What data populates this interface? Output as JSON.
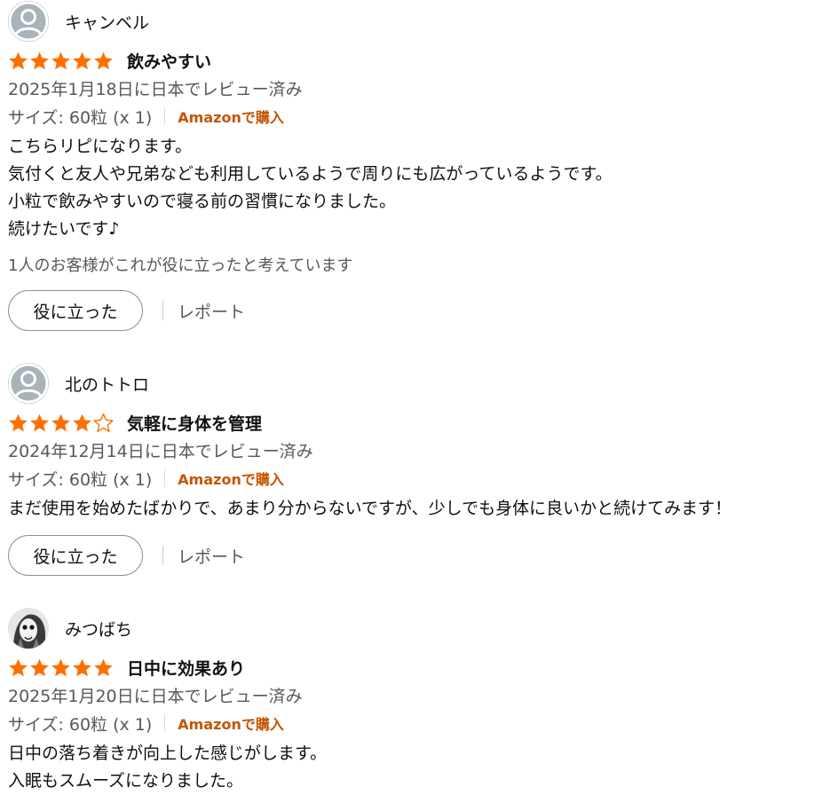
{
  "colors": {
    "star_fill": "#ff6f00",
    "star_empty": "#ff6f00",
    "verified": "#c45500",
    "secondary_text": "#565959",
    "avatar_bg": "#a8b3ba"
  },
  "reviews": [
    {
      "profile_name": "キャンベル",
      "avatar_icon": "default-person-icon",
      "rating": 5,
      "rating_max": 5,
      "title": "飲みやすい",
      "date": "2025年1月18日に日本でレビュー済み",
      "variant": "サイズ: 60粒 (x 1)",
      "verified_label": "Amazonで購入",
      "body": [
        "こちらリピになります。",
        "気付くと友人や兄弟なども利用しているようで周りにも広がっているようです。",
        "小粒で飲みやすいので寝る前の習慣になりました。",
        "続けたいです♪"
      ],
      "helpful_count": "1人のお客様がこれが役に立ったと考えています",
      "helpful_button": "役に立った",
      "report_link": "レポート"
    },
    {
      "profile_name": "北のトトロ",
      "avatar_icon": "default-person-icon",
      "rating": 4,
      "rating_max": 5,
      "title": "気軽に身体を管理",
      "date": "2024年12月14日に日本でレビュー済み",
      "variant": "サイズ: 60粒 (x 1)",
      "verified_label": "Amazonで購入",
      "body": [
        "まだ使用を始めたばかりで、あまり分からないですが、少しでも身体に良いかと続けてみます！"
      ],
      "helpful_count": "",
      "helpful_button": "役に立った",
      "report_link": "レポート"
    },
    {
      "profile_name": "みつばち",
      "avatar_icon": "photo-avatar-icon",
      "rating": 5,
      "rating_max": 5,
      "title": "日中に効果あり",
      "date": "2025年1月20日に日本でレビュー済み",
      "variant": "サイズ: 60粒 (x 1)",
      "verified_label": "Amazonで購入",
      "body": [
        "日中の落ち着きが向上した感じがします。",
        "入眠もスムーズになりました。"
      ],
      "helpful_count": "",
      "helpful_button": "",
      "report_link": ""
    }
  ]
}
